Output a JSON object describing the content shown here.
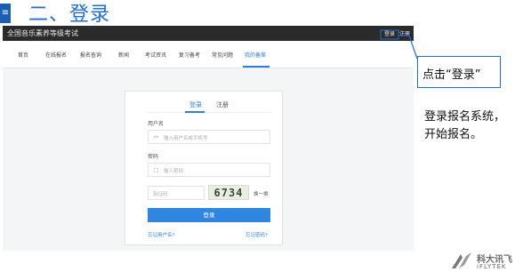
{
  "slide": {
    "marker": "≡",
    "title": "二、登录"
  },
  "site": {
    "name": "全国音乐素养等级考试",
    "login_link": "登录",
    "register_link": "注册"
  },
  "nav": {
    "items": [
      "首页",
      "在线报名",
      "报名查询",
      "新闻",
      "考试资讯",
      "复习备考",
      "常见问题",
      "我的备案"
    ],
    "active_index": 7
  },
  "login_card": {
    "tabs": [
      "登录",
      "注册"
    ],
    "active_tab": 0,
    "username_label": "用户名",
    "username_placeholder": "输入用户名或手机号",
    "password_label": "密码",
    "password_placeholder": "输入密码",
    "captcha_placeholder": "验证码",
    "captcha_text": "6734",
    "refresh_label": "换一换",
    "submit_label": "登录",
    "forgot_user": "忘记用户名?",
    "forgot_pass": "忘记密码?"
  },
  "callout": {
    "text": "点击“登录”"
  },
  "description": {
    "lines": [
      "登录报名系统，",
      "开始报名。"
    ]
  },
  "logo": {
    "cn": "科大讯飞",
    "en": "iFLYTEK"
  },
  "colors": {
    "accent": "#1e6fd6",
    "topbar": "#2b2b2b",
    "button": "#2f86e0"
  }
}
